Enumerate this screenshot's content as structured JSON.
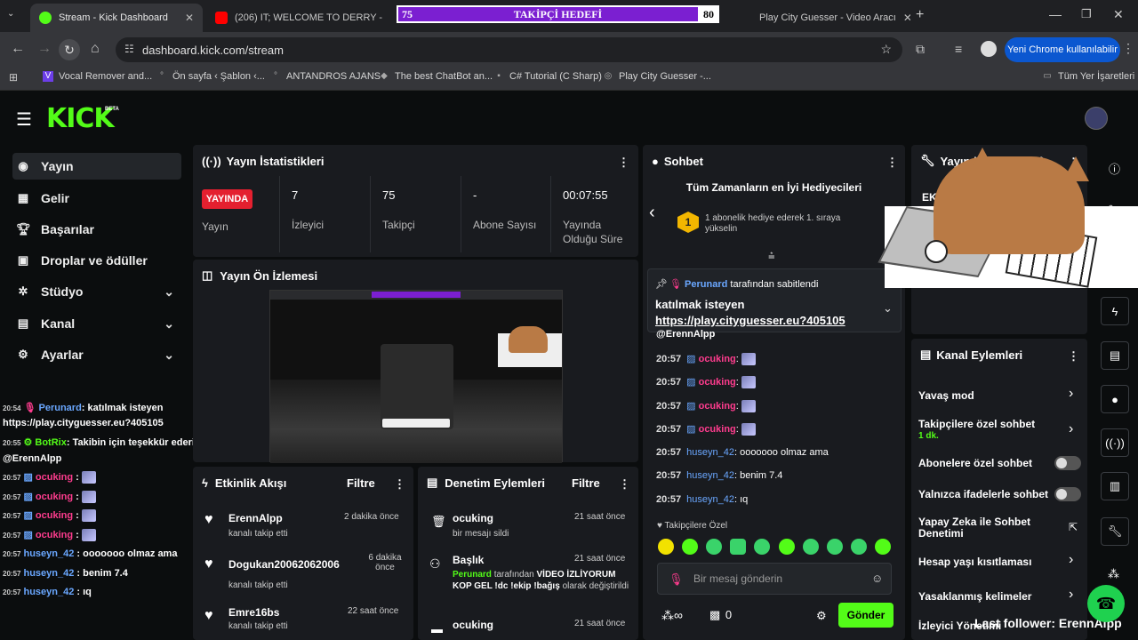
{
  "browser": {
    "tabs": [
      {
        "title": "Stream - Kick Dashboard"
      },
      {
        "title": "(206) IT; WELCOME TO DERRY -"
      },
      {
        "title": "Play City Guesser - Video Aracı"
      }
    ],
    "url": "dashboard.kick.com/stream",
    "new_chrome_label": "Yeni Chrome kullanılabilir",
    "bookmarks": [
      "Vocal Remover and...",
      "Ön sayfa ‹ Şablon ‹...",
      "ANTANDROS AJANS",
      "The best ChatBot an...",
      "C# Tutorial (C Sharp)",
      "Play City Guesser -..."
    ],
    "all_bookmarks": "Tüm Yer İşaretleri"
  },
  "goal": {
    "left": "75",
    "title": "TAKİPÇİ HEDEFİ",
    "right": "80",
    "progress": 0.94
  },
  "brand": {
    "logo": "KICK",
    "beta": "BETA"
  },
  "sidebar": {
    "items": [
      {
        "label": "Yayın"
      },
      {
        "label": "Gelir"
      },
      {
        "label": "Başarılar"
      },
      {
        "label": "Droplar ve ödüller"
      },
      {
        "label": "Stüdyo"
      },
      {
        "label": "Kanal"
      },
      {
        "label": "Ayarlar"
      }
    ]
  },
  "overlay_chat": [
    {
      "ts": "20:54",
      "user": "Perunard",
      "text": ": katılmak isteyen"
    },
    {
      "ts": "",
      "user": "",
      "text": "https://play.cityguesser.eu?405105"
    },
    {
      "ts": "20:55",
      "user": "BotRix",
      "text": ": Takibin için teşekkür ederimm"
    },
    {
      "ts": "",
      "user": "",
      "text": "@ErennAlpp"
    },
    {
      "ts": "20:57",
      "user": "ocuking",
      "text": " :"
    },
    {
      "ts": "20:57",
      "user": "ocuking",
      "text": " :"
    },
    {
      "ts": "20:57",
      "user": "ocuking",
      "text": " :"
    },
    {
      "ts": "20:57",
      "user": "ocuking",
      "text": " :"
    },
    {
      "ts": "20:57",
      "user": "huseyn_42",
      "text": " : ooooooo olmaz ama"
    },
    {
      "ts": "20:57",
      "user": "huseyn_42",
      "text": " : benim 7.4"
    },
    {
      "ts": "20:57",
      "user": "huseyn_42",
      "text": " : ıq"
    }
  ],
  "stats": {
    "title": "Yayın İstatistikleri",
    "live_badge": "YAYINDA",
    "live_label": "Yayın",
    "viewers_value": "7",
    "viewers_label": "İzleyici",
    "followers_value": "75",
    "followers_label": "Takipçi",
    "subs_value": "-",
    "subs_label": "Abone Sayısı",
    "uptime_value": "00:07:55",
    "uptime_label": "Yayında Olduğu Süre"
  },
  "preview": {
    "title": "Yayın Ön İzlemesi"
  },
  "activity": {
    "title": "Etkinlik Akışı",
    "filter": "Filtre",
    "items": [
      {
        "name": "ErennAlpp",
        "time": "2 dakika önce",
        "desc": "kanalı takip etti"
      },
      {
        "name": "Dogukan20062062006",
        "time": "6 dakika önce",
        "desc": "kanalı takip etti"
      },
      {
        "name": "Emre16bs",
        "time": "22 saat önce",
        "desc": "kanalı takip etti"
      }
    ]
  },
  "moderation": {
    "title": "Denetim Eylemleri",
    "filter": "Filtre",
    "items": [
      {
        "name": "ocuking",
        "time": "21 saat önce",
        "desc": "bir mesajı sildi"
      },
      {
        "name": "Başlık",
        "time": "21 saat önce",
        "by": "Perunard",
        "by_text": "tarafından",
        "new_title": "VİDEO İZLİYORUM KOP GEL !dc !ekip !bağış",
        "after": "olarak değiştirildi"
      },
      {
        "name": "ocuking",
        "time": "21 saat önce"
      }
    ]
  },
  "chat": {
    "title": "Sohbet",
    "top_gifters": "Tüm Zamanların en İyi Hediyecileri",
    "rank": "1",
    "gifter_text": "1 abonelik hediye ederek 1. sıraya yükselin",
    "pinned_by": "Perunard",
    "pinned_by_text": "tarafından sabitlendi",
    "pinned_text": "katılmak isteyen",
    "pinned_link": "https://play.cityguesser.eu?405105",
    "mention": "@ErennAlpp",
    "messages": [
      {
        "ts": "20:57",
        "user": "ocuking",
        "text": ":"
      },
      {
        "ts": "20:57",
        "user": "ocuking",
        "text": ":"
      },
      {
        "ts": "20:57",
        "user": "ocuking",
        "text": ":"
      },
      {
        "ts": "20:57",
        "user": "ocuking",
        "text": ":"
      },
      {
        "ts": "20:57",
        "user": "huseyn_42",
        "text": ": ooooooo olmaz ama"
      },
      {
        "ts": "20:57",
        "user": "huseyn_42",
        "text": ": benim 7.4"
      },
      {
        "ts": "20:57",
        "user": "huseyn_42",
        "text": ": ıq"
      }
    ],
    "followers_only": "Takipçilere Özel",
    "input_placeholder": "Bir mesaj gönderin",
    "infinity": "∞",
    "count": "0",
    "send": "Gönder"
  },
  "stream_info": {
    "title": "Yayın bilgisi",
    "cat": "EKİ"
  },
  "channel_actions": {
    "title": "Kanal Eylemleri",
    "slow_mode": "Yavaş mod",
    "followers_chat": "Takipçilere özel sohbet",
    "followers_chat_sub": "1 dk.",
    "subs_chat": "Abonelere özel sohbet",
    "emote_chat": "Yalnızca ifadelerle sohbet",
    "ai_mod": "Yapay Zeka ile Sohbet Denetimi",
    "age_limit": "Hesap yaşı kısıtlaması",
    "banned_words": "Yasaklanmış kelimeler",
    "viewer_manage": "İzleyici Yönetimi"
  },
  "last_follower": "Last follower: ErennAlpp",
  "colors": {
    "kick_green": "#53fc18",
    "panel": "#191b1f",
    "live_red": "#e4202f",
    "goal_purple": "#7b1fd1"
  }
}
